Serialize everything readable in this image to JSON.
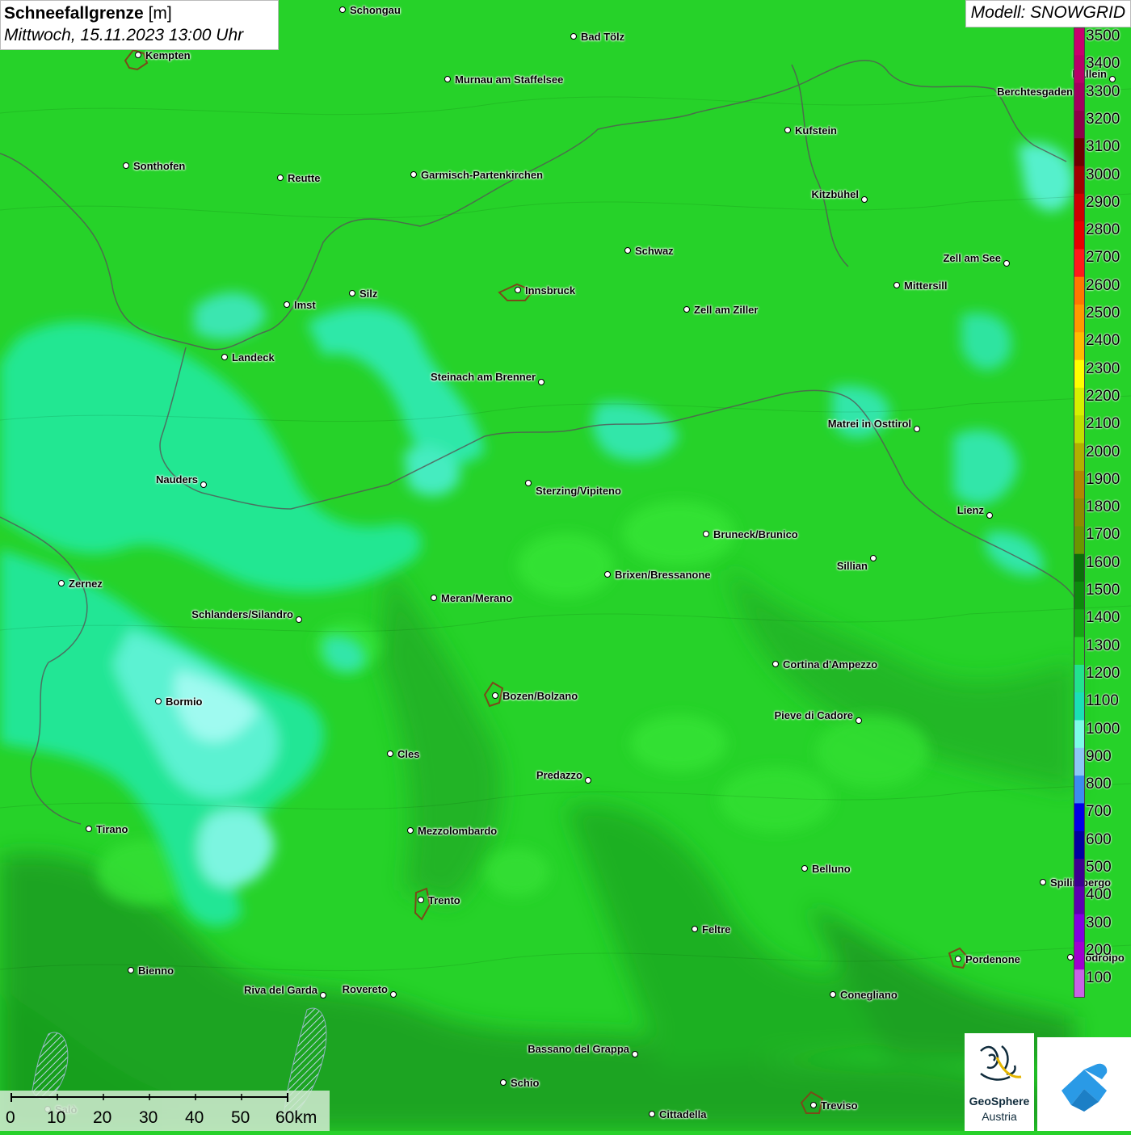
{
  "title": {
    "parameter": "Schneefallgrenze",
    "unit": "[m]",
    "datetime": "Mittwoch, 15.11.2023 13:00 Uhr"
  },
  "model": "Modell: SNOWGRID",
  "legend": {
    "values": [
      "3500",
      "3400",
      "3300",
      "3200",
      "3100",
      "3000",
      "2900",
      "2800",
      "2700",
      "2600",
      "2500",
      "2400",
      "2300",
      "2200",
      "2100",
      "2000",
      "1900",
      "1800",
      "1700",
      "1600",
      "1500",
      "1400",
      "1300",
      "1200",
      "1100",
      "1000",
      "900",
      "800",
      "700",
      "600",
      "500",
      "400",
      "300",
      "200",
      "100"
    ],
    "colors": [
      "#c8006e",
      "#b80068",
      "#a3005e",
      "#8e0048",
      "#6e0000",
      "#a00000",
      "#cc0000",
      "#e60000",
      "#ff1a1a",
      "#ff7700",
      "#ff9900",
      "#ffbb00",
      "#ffff00",
      "#d6f000",
      "#c0e000",
      "#b0b000",
      "#b08800",
      "#8c8c00",
      "#6a9600",
      "#0a6e0a",
      "#0c8a0c",
      "#14a814",
      "#25d425",
      "#22e38e",
      "#1ae0b5",
      "#7cfce6",
      "#8cc8f5",
      "#3c8cf0",
      "#0000e6",
      "#0000a0",
      "#3c0090",
      "#5c00b0",
      "#8200e0",
      "#a000d0",
      "#c864e6"
    ]
  },
  "cities": [
    {
      "name": "Schongau"
    },
    {
      "name": "Bad Tölz"
    },
    {
      "name": "Kempten"
    },
    {
      "name": "Murnau am Staffelsee"
    },
    {
      "name": "Berchtesgaden"
    },
    {
      "name": "Kufstein"
    },
    {
      "name": "Sonthofen"
    },
    {
      "name": "Reutte"
    },
    {
      "name": "Garmisch-Partenkirchen"
    },
    {
      "name": "Kitzbühel"
    },
    {
      "name": "Schwaz"
    },
    {
      "name": "Zell am See"
    },
    {
      "name": "Imst"
    },
    {
      "name": "Silz"
    },
    {
      "name": "Innsbruck"
    },
    {
      "name": "Mittersill"
    },
    {
      "name": "Zell am Ziller"
    },
    {
      "name": "Landeck"
    },
    {
      "name": "Steinach am Brenner"
    },
    {
      "name": "Matrei in Osttirol"
    },
    {
      "name": "Nauders"
    },
    {
      "name": "Sterzing/Vipiteno"
    },
    {
      "name": "Lienz"
    },
    {
      "name": "Bruneck/Brunico"
    },
    {
      "name": "Sillian"
    },
    {
      "name": "Zernez"
    },
    {
      "name": "Brixen/Bressanone"
    },
    {
      "name": "Meran/Merano"
    },
    {
      "name": "Schlanders/Silandro"
    },
    {
      "name": "Cortina d'Ampezzo"
    },
    {
      "name": "Bozen/Bolzano"
    },
    {
      "name": "Bormio"
    },
    {
      "name": "Pieve di Cadore"
    },
    {
      "name": "Cles"
    },
    {
      "name": "Predazzo"
    },
    {
      "name": "Tirano"
    },
    {
      "name": "Mezzolombardo"
    },
    {
      "name": "Belluno"
    },
    {
      "name": "Spilimbergo"
    },
    {
      "name": "Trento"
    },
    {
      "name": "Feltre"
    },
    {
      "name": "Pordenone"
    },
    {
      "name": "Bienno"
    },
    {
      "name": "Riva del Garda"
    },
    {
      "name": "Rovereto"
    },
    {
      "name": "Conegliano"
    },
    {
      "name": "Bassano del Grappa"
    },
    {
      "name": "Schio"
    },
    {
      "name": "Treviso"
    },
    {
      "name": "Cittadella"
    },
    {
      "name": "Hallein"
    },
    {
      "name": "Codroipo"
    },
    {
      "name": "Salò"
    }
  ],
  "scale": {
    "ticks": [
      "0",
      "10",
      "20",
      "30",
      "40",
      "50",
      "60km"
    ]
  },
  "logos": {
    "geosphere_line1": "GeoSphere",
    "geosphere_line2": "Austria"
  }
}
